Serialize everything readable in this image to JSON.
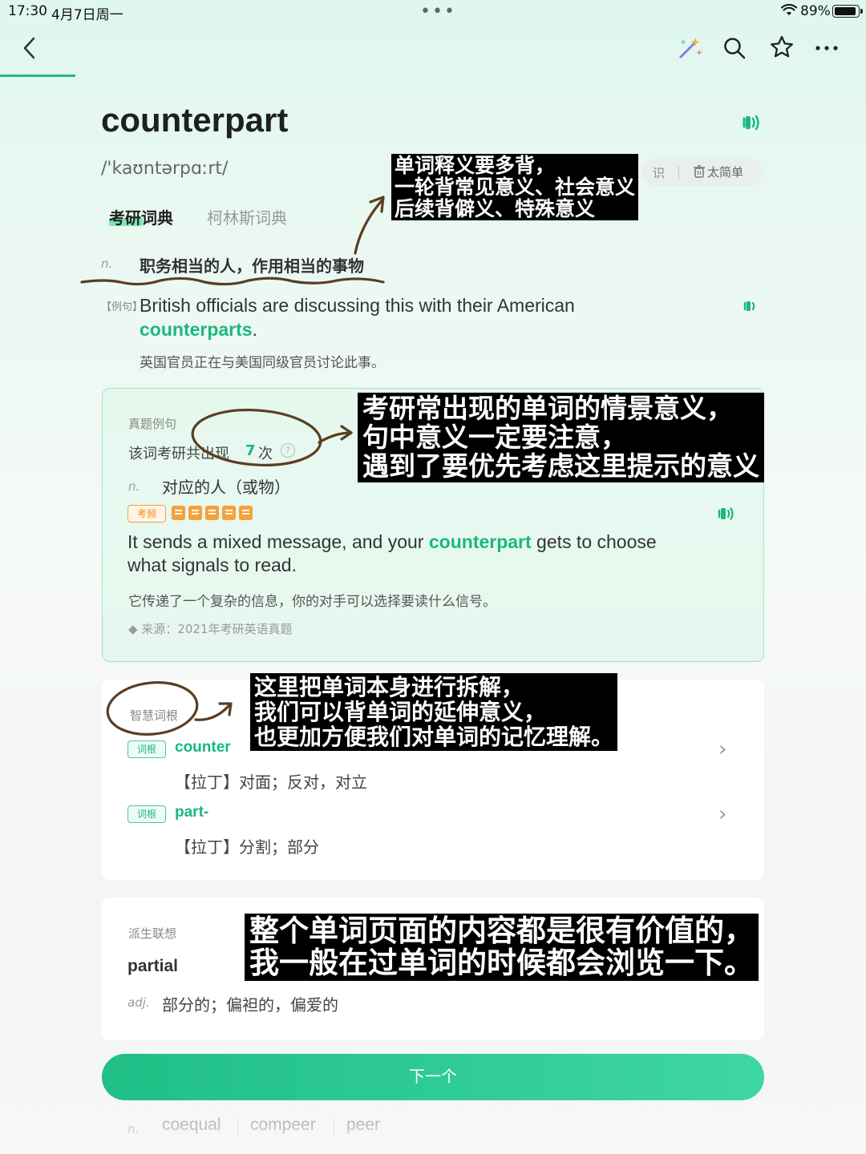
{
  "status_bar": {
    "time": "17:30",
    "date": "4月7日周一",
    "battery": "89%"
  },
  "toolbar": {
    "icons": [
      "back-icon",
      "magic-wand-icon",
      "search-icon",
      "star-icon",
      "more-icon"
    ]
  },
  "word": {
    "headword": "counterpart",
    "phonetic": "/'kaʊntərpɑːrt/",
    "pill_left": "识",
    "pill_label": "太简单"
  },
  "tabs": [
    "考研词典",
    "柯林斯词典"
  ],
  "definition": {
    "pos": "n.",
    "meaning": "职务相当的人，作用相当的事物",
    "example_tag": "【例句】",
    "example_en_pre": "British officials are discussing this with their American ",
    "example_en_hl": "counterparts",
    "example_en_post": ".",
    "example_cn": "英国官员正在与美国同级官员讨论此事。"
  },
  "exam": {
    "label": "真题例句",
    "count_pre": "该词考研共出现",
    "count_num": "7",
    "count_post": "次",
    "help": "?",
    "pos": "n.",
    "meaning": "对应的人（或物）",
    "freq_badge": "考频",
    "freq_level": 5,
    "sentence_pre": "It sends a mixed message, and your ",
    "sentence_hl": "counterpart",
    "sentence_post": " gets to choose what signals to read.",
    "sentence_cn": "它传递了一个复杂的信息，你的对手可以选择要读什么信号。",
    "source": "◆ 来源：2021年考研英语真题"
  },
  "roots": {
    "label": "智慧词根",
    "items": [
      {
        "tag": "词根",
        "word": "counter",
        "meaning": "【拉丁】对面；反对，对立"
      },
      {
        "tag": "词根",
        "word": "part-",
        "meaning": "【拉丁】分割；部分"
      }
    ]
  },
  "derived": {
    "label": "派生联想",
    "word": "partial",
    "pos": "adj.",
    "meaning": "部分的；偏袒的，偏爱的"
  },
  "next_button": "下一个",
  "synonyms": {
    "pos": "n.",
    "words": [
      "coequal",
      "compeer",
      "peer"
    ]
  },
  "annotations": {
    "note1": "单词释义要多背，\n一轮背常见意义、社会意义\n后续背僻义、特殊意义",
    "note2": "考研常出现的单词的情景意义，\n句中意义一定要注意，\n遇到了要优先考虑这里提示的意义",
    "note3": "这里把单词本身进行拆解，\n我们可以背单词的延伸意义，\n也更加方便我们对单词的记忆理解。",
    "note4": "整个单词页面的内容都是很有价值的，\n我一般在过单词的时候都会浏览一下。"
  },
  "colors": {
    "accent": "#1ab87f",
    "freq": "#f6a13a",
    "ink": "#5a3e22"
  }
}
